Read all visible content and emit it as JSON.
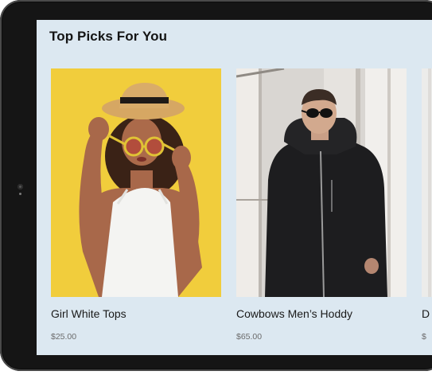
{
  "section": {
    "title": "Top Picks For You"
  },
  "products": [
    {
      "name": "Girl White Tops",
      "price": "$25.00",
      "image_icon": "woman-straw-hat-photo"
    },
    {
      "name": "Cowbows Men’s Hoddy",
      "price": "$65.00",
      "image_icon": "man-black-hoodie-photo"
    },
    {
      "name": "D",
      "price": "$",
      "image_icon": "product-photo"
    }
  ],
  "colors": {
    "screen_background": "#dce8f1",
    "tablet_bezel": "#151515",
    "photo_1_background": "#f1cd3c",
    "photo_2_background": "#d9d6d2"
  }
}
